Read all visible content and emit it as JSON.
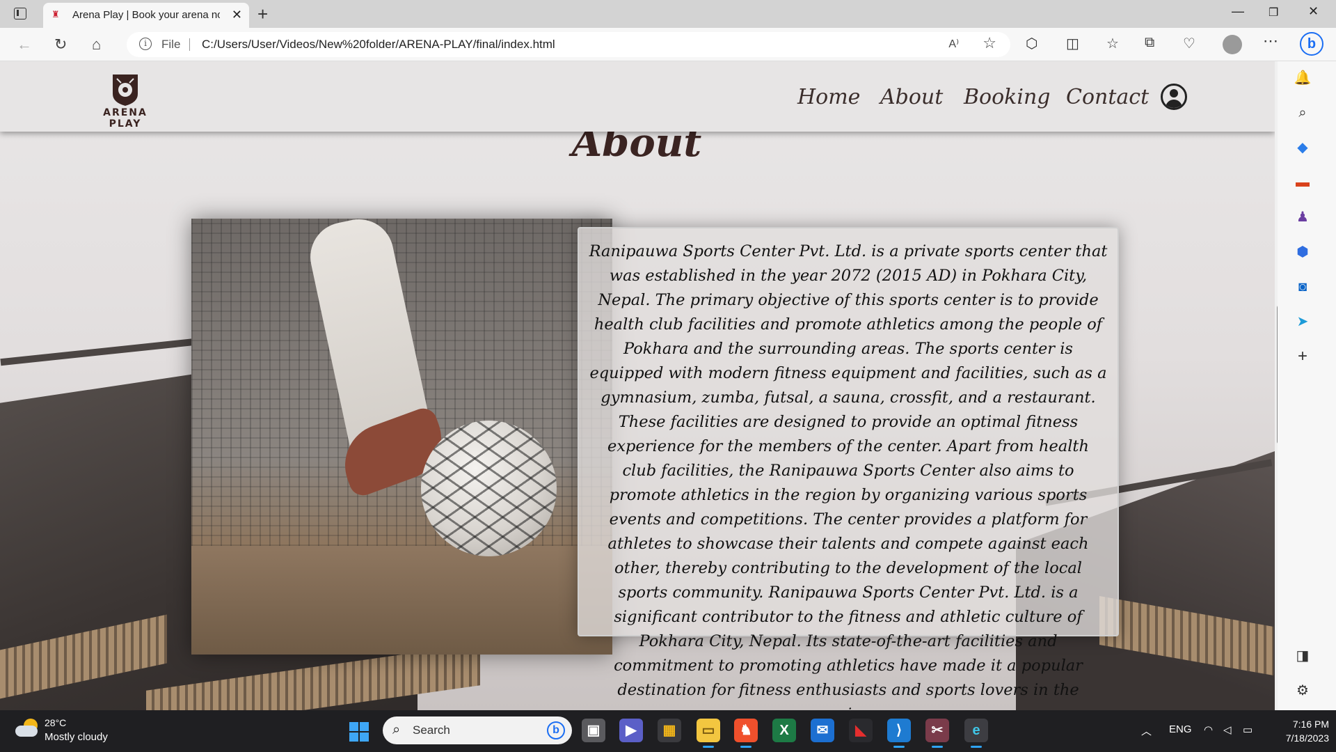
{
  "browser": {
    "tab_title": "Arena Play | Book your arena now",
    "new_tab_symbol": "+",
    "file_label": "File",
    "url": "C:/Users/User/Videos/New%20folder/ARENA-PLAY/final/index.html"
  },
  "site": {
    "logo_text": "ARENA PLAY",
    "nav": {
      "home": "Home",
      "about": "About",
      "booking": "Booking",
      "contact": "Contact"
    },
    "section_title": "About",
    "about_text": "Ranipauwa Sports Center Pvt. Ltd. is a private sports center that was established in the year 2072 (2015 AD) in Pokhara City, Nepal. The primary objective of this sports center is to provide health club facilities and promote athletics among the people of Pokhara and the surrounding areas. The sports center is equipped with modern fitness equipment and facilities, such as a gymnasium, zumba, futsal, a sauna, crossfit, and a restaurant. These facilities are designed to provide an optimal fitness experience for the members of the center. Apart from health club facilities, the Ranipauwa Sports Center also aims to promote athletics in the region by organizing various sports events and competitions. The center provides a platform for athletes to showcase their talents and compete against each other, thereby contributing to the development of the local sports community. Ranipauwa Sports Center Pvt. Ltd. is a significant contributor to the fitness and athletic culture of Pokhara City, Nepal. Its state-of-the-art facilities and commitment to promoting athletics have made it a popular destination for fitness enthusiasts and sports lovers in the region."
  },
  "taskbar": {
    "weather_temp": "28°C",
    "weather_desc": "Mostly cloudy",
    "search_label": "Search",
    "language": "ENG",
    "time": "7:16 PM",
    "date": "7/18/2023"
  },
  "colors": {
    "brand_brown": "#3b2422",
    "edge_blue": "#1b6ef3",
    "taskbar": "#1f1f22"
  }
}
